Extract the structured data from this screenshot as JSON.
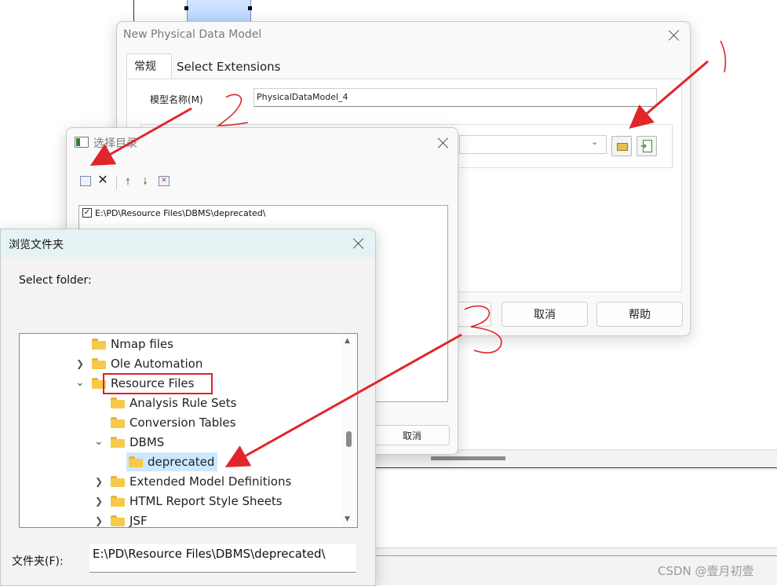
{
  "main_dialog": {
    "title": "New Physical Data Model",
    "tabs": [
      {
        "label": "常规"
      },
      {
        "label": "Select Extensions"
      }
    ],
    "model_name_label": "模型名称(M)",
    "model_name_value": "PhysicalDataModel_4",
    "cancel_label": "取消",
    "help_label": "帮助"
  },
  "select_dir_dialog": {
    "title": "选择目录",
    "path_item": "E:\\PD\\Resource Files\\DBMS\\deprecated\\",
    "cancel_label": "取消"
  },
  "browse_dialog": {
    "title": "浏览文件夹",
    "prompt": "Select folder:",
    "tree": [
      {
        "label": "Nmap files"
      },
      {
        "label": "Ole Automation"
      },
      {
        "label": "Resource Files"
      },
      {
        "label": "Analysis Rule Sets"
      },
      {
        "label": "Conversion Tables"
      },
      {
        "label": "DBMS"
      },
      {
        "label": "deprecated"
      },
      {
        "label": "Extended Model Definitions"
      },
      {
        "label": "HTML Report Style Sheets"
      },
      {
        "label": "JSF"
      }
    ],
    "folder_label": "文件夹(F):",
    "folder_value": "E:\\PD\\Resource Files\\DBMS\\deprecated\\"
  },
  "annotations": {
    "one": "1",
    "two": "2",
    "three": "3"
  },
  "watermark": "CSDN @壹月初壹",
  "colors": {
    "arrow": "#e0262b",
    "highlight_box": "#e02020",
    "selection": "#cce8ff",
    "folder": "#f7c94a"
  }
}
